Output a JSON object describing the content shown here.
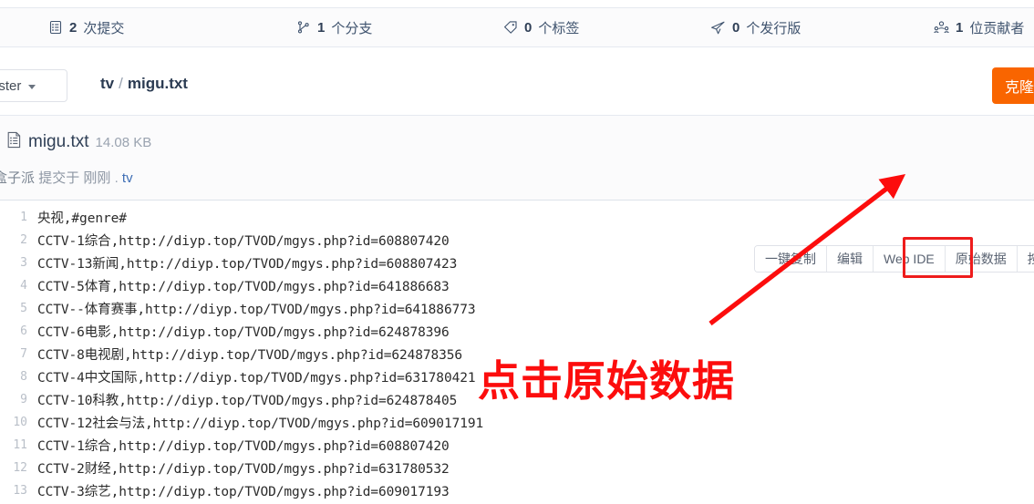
{
  "stats": [
    {
      "id": "commits",
      "icon": "commit-list-icon",
      "num": "2",
      "label": "次提交"
    },
    {
      "id": "branches",
      "icon": "branch-icon",
      "num": "1",
      "label": "个分支"
    },
    {
      "id": "tags",
      "icon": "tag-icon",
      "num": "0",
      "label": "个标签"
    },
    {
      "id": "releases",
      "icon": "release-send-icon",
      "num": "0",
      "label": "个发行版"
    },
    {
      "id": "contrib",
      "icon": "contributors-icon",
      "num": "1",
      "label": "位贡献者"
    }
  ],
  "branch": {
    "label": "aster",
    "caret_icon": "chevron-down-icon"
  },
  "breadcrumb": {
    "root": "tv",
    "separator": "/",
    "file": "migu.txt"
  },
  "clone_button": {
    "label": "克隆",
    "color": "#f96500"
  },
  "file": {
    "icon": "file-text-icon",
    "name": "migu.txt",
    "size": "14.08 KB",
    "author": "盒子派",
    "commit_verb": "提交于",
    "time": "刚刚",
    "dot": ".",
    "path": "tv"
  },
  "actions": [
    {
      "id": "copy",
      "label": "一键复制"
    },
    {
      "id": "edit",
      "label": "编辑"
    },
    {
      "id": "web-ide",
      "label": "Web IDE"
    },
    {
      "id": "raw",
      "label": "原始数据",
      "highlighted": true
    },
    {
      "id": "blame",
      "label": "按行查看"
    }
  ],
  "highlight": {
    "color": "#ee1c1c"
  },
  "annotation": {
    "text": "点击原始数据",
    "color": "#fc0d0d",
    "arrow_icon": "arrow-up-right-icon"
  },
  "code_lines": [
    {
      "n": "1",
      "text": "央视,#genre#"
    },
    {
      "n": "2",
      "text": "CCTV-1综合,http://diyp.top/TVOD/mgys.php?id=608807420"
    },
    {
      "n": "3",
      "text": "CCTV-13新闻,http://diyp.top/TVOD/mgys.php?id=608807423"
    },
    {
      "n": "4",
      "text": "CCTV-5体育,http://diyp.top/TVOD/mgys.php?id=641886683"
    },
    {
      "n": "5",
      "text": "CCTV--体育赛事,http://diyp.top/TVOD/mgys.php?id=641886773"
    },
    {
      "n": "6",
      "text": "CCTV-6电影,http://diyp.top/TVOD/mgys.php?id=624878396"
    },
    {
      "n": "7",
      "text": "CCTV-8电视剧,http://diyp.top/TVOD/mgys.php?id=624878356"
    },
    {
      "n": "8",
      "text": "CCTV-4中文国际,http://diyp.top/TVOD/mgys.php?id=631780421"
    },
    {
      "n": "9",
      "text": "CCTV-10科教,http://diyp.top/TVOD/mgys.php?id=624878405"
    },
    {
      "n": "10",
      "text": "CCTV-12社会与法,http://diyp.top/TVOD/mgys.php?id=609017191"
    },
    {
      "n": "11",
      "text": "CCTV-1综合,http://diyp.top/TVOD/mgys.php?id=608807420"
    },
    {
      "n": "12",
      "text": "CCTV-2财经,http://diyp.top/TVOD/mgys.php?id=631780532"
    },
    {
      "n": "13",
      "text": "CCTV-3综艺,http://diyp.top/TVOD/mgys.php?id=609017193"
    }
  ]
}
